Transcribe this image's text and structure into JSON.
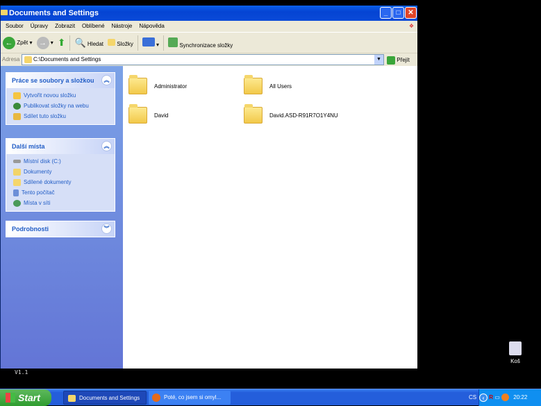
{
  "window": {
    "title": "Documents and Settings"
  },
  "menu": [
    "Soubor",
    "Úpravy",
    "Zobrazit",
    "Oblíbené",
    "Nástroje",
    "Nápověda"
  ],
  "toolbar": {
    "back": "Zpět",
    "search": "Hledat",
    "folders": "Složky",
    "sync": "Synchronizace složky"
  },
  "address": {
    "label": "Adresa",
    "value": "C:\\Documents and Settings",
    "go": "Přejít"
  },
  "panels": {
    "tasks": {
      "title": "Práce se soubory a složkou",
      "items": [
        "Vytvořit novou složku",
        "Publikovat složky na webu",
        "Sdílet tuto složku"
      ]
    },
    "places": {
      "title": "Další místa",
      "items": [
        "Místní disk (C:)",
        "Dokumenty",
        "Sdílené dokumenty",
        "Tento počítač",
        "Místa v síti"
      ]
    },
    "details": {
      "title": "Podrobnosti"
    }
  },
  "folders": [
    "Administrator",
    "All Users",
    "David",
    "David.ASD-R91R7O1Y4NU"
  ],
  "desktop": {
    "version": "V1.1",
    "recycle_bin": "Koš"
  },
  "taskbar": {
    "start": "Start",
    "tasks": [
      "Documents and Settings",
      "Poté, co jsem si omyl..."
    ],
    "lang": "CS",
    "clock": "20:22"
  }
}
